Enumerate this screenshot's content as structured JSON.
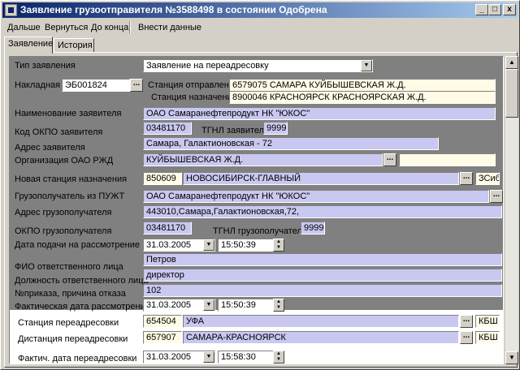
{
  "window": {
    "title": "Заявление грузоотправителя №3588498 в состоянии Одобрена",
    "min": "_",
    "max": "□",
    "close": "x"
  },
  "menu": {
    "next": "Дальше",
    "back": "Вернуться",
    "to_end": "До конца",
    "enter_data": "Внести данные"
  },
  "tabs": {
    "statement": "Заявление",
    "history": "История"
  },
  "form": {
    "type_label": "Тип заявления",
    "type_value": "Заявление на переадресовку",
    "waybill_label": "Накладная",
    "waybill_value": "ЭБ001824",
    "dep_label": "Станция отправления",
    "dep_value": "6579075   САМАРА    КУЙБЫШЕВСКАЯ Ж.Д.",
    "dest_label": "Станция назначения",
    "dest_value": "8900046   КРАСНОЯРСК    КРАСНОЯРСКАЯ Ж.Д.",
    "applicant_label": "Наименование заявителя",
    "applicant_value": "ОАО Самаранефтепродукт НК \"ЮКОС\"",
    "okpo_label": "Код ОКПО заявителя",
    "okpo_value": "03481170",
    "tgnl_label": "ТГНЛ заявителя",
    "tgnl_value": "9999",
    "addr_label": "Адрес заявителя",
    "addr_value": "Самара, Галактионовская - 72",
    "org_label": "Организация ОАО РЖД",
    "org_value": "КУЙБЫШЕВСКАЯ Ж.Д.",
    "newst_label": "Новая станция назначения",
    "newst_code": "850609",
    "newst_name": "НОВОСИБИРСК-ГЛАВНЫЙ",
    "newst_rw": "ЗСиб",
    "consignee_label": "Грузополучатель из ПУЖТ",
    "consignee_value": "ОАО Самаранефтепродукт НК \"ЮКОС\"",
    "caddr_label": "Адрес грузополучателя",
    "caddr_value": "443010,Самара,Галактионовская,72,",
    "cokpo_label": "ОКПО грузополучателя",
    "cokpo_value": "03481170",
    "ctgnl_label": "ТГНЛ грузополучателя",
    "ctgnl_value": "9999",
    "submit_label": "Дата подачи на рассмотрение",
    "submit_date": "31.03.2005",
    "submit_time": "15:50:39",
    "resp_label": "ФИО ответственного лица",
    "resp_value": "Петров",
    "pos_label": "Должность ответственного лица",
    "pos_value": "директор",
    "order_label": "№приказа, причина отказа",
    "order_value": "102",
    "review_label": "Фактическая дата рассмотрения",
    "review_date": "31.03.2005",
    "review_time": "15:50:39",
    "rst_label": "Станция переадресовки",
    "rst_code": "654504",
    "rst_name": "УФА",
    "rst_rw": "КБШ",
    "rdist_label": "Дистанция переадресовки",
    "rdist_code": "657907",
    "rdist_name": "САМАРА-КРАСНОЯРСК",
    "rdist_rw": "КБШ",
    "rdate_label": "Фактич. дата переадресовки",
    "rdate_date": "31.03.2005",
    "rdate_time": "15:58:30"
  }
}
